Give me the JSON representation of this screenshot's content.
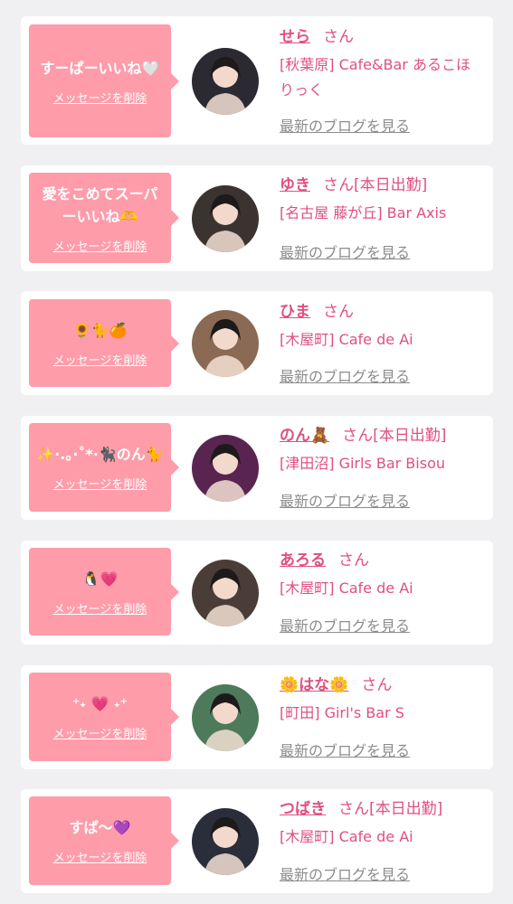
{
  "common": {
    "delete_label": "メッセージを削除",
    "blog_label": "最新のブログを見る",
    "honorific": "さん"
  },
  "cards": [
    {
      "message": "すーぱーいいね🤍",
      "name": "せら",
      "status": "",
      "shop": "[秋葉原] Cafe&Bar あるこほりっく",
      "avatar_color": "#2b2a33"
    },
    {
      "message": "愛をこめてスーパーいいね🫶",
      "name": "ゆき",
      "status": "[本日出勤]",
      "shop": "[名古屋 藤が丘] Bar Axis",
      "avatar_color": "#3a3330"
    },
    {
      "message": "🌻🐈🍊",
      "name": "ひま",
      "status": "",
      "shop": "[木屋町] Cafe de Ai",
      "avatar_color": "#8a6a55"
    },
    {
      "message": "✨·.。·˚*·🐈‍⬛のん🐈",
      "name": "のん🧸",
      "status": "[本日出勤]",
      "shop": "[津田沼] Girls Bar Bisou",
      "avatar_color": "#5a2450"
    },
    {
      "message": "🐧💗",
      "name": "あろる",
      "status": "",
      "shop": "[木屋町] Cafe de Ai",
      "avatar_color": "#4a3d38"
    },
    {
      "message": "⁺˖ 💗 ˖⁺",
      "name": "🌼はな🌼",
      "status": "",
      "shop": "[町田] Girl's Bar S",
      "avatar_color": "#4d7a5a"
    },
    {
      "message": "すぱ〜💜",
      "name": "つばき",
      "status": "[本日出勤]",
      "shop": "[木屋町] Cafe de Ai",
      "avatar_color": "#2a2d3a"
    }
  ]
}
